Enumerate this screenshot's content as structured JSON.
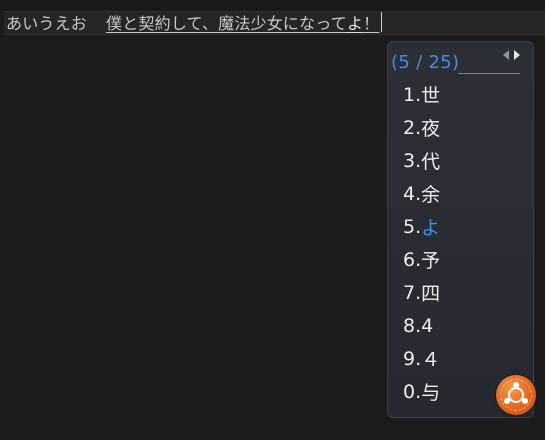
{
  "editor": {
    "committed_text": "あいうえお",
    "preedit_text": "僕と契約して、魔法少女になって",
    "preedit_highlight": "よ",
    "preedit_tail": "！"
  },
  "candidate_window": {
    "counter": "(5 / 25)",
    "selected_index": 5,
    "candidates": [
      {
        "index": "1.",
        "word": "世"
      },
      {
        "index": "2.",
        "word": "夜"
      },
      {
        "index": "3.",
        "word": "代"
      },
      {
        "index": "4.",
        "word": "余"
      },
      {
        "index": "5.",
        "word": "よ"
      },
      {
        "index": "6.",
        "word": "予"
      },
      {
        "index": "7.",
        "word": "四"
      },
      {
        "index": "8.",
        "word": "4"
      },
      {
        "index": "9.",
        "word": "４"
      },
      {
        "index": "0.",
        "word": "与"
      }
    ]
  },
  "icons": {
    "prev_page": "triangle-left-icon",
    "next_page": "triangle-right-icon",
    "tray": "ubuntu-logo-icon"
  },
  "colors": {
    "background": "#1c1c1c",
    "panel": "#2a2e34",
    "accent": "#3c8fe6",
    "text": "#ededed",
    "logo": "#e3651d"
  }
}
